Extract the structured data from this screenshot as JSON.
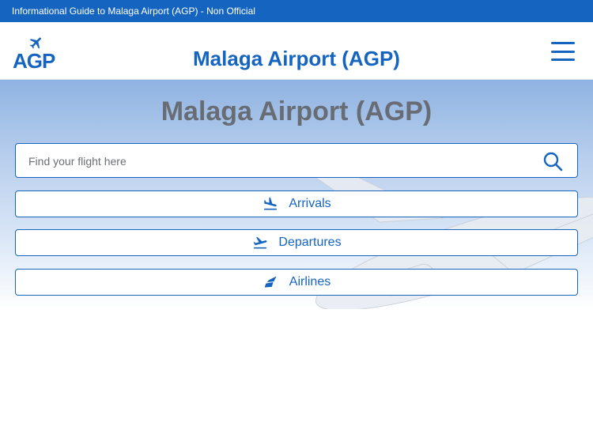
{
  "topbar": {
    "text": "Informational Guide to Malaga Airport (AGP) - Non Official"
  },
  "header": {
    "logo_text": "AGP",
    "title": "Malaga Airport (AGP)"
  },
  "hero": {
    "title": "Malaga Airport (AGP)"
  },
  "search": {
    "placeholder": "Find your flight here"
  },
  "nav": {
    "arrivals": "Arrivals",
    "departures": "Departures",
    "airlines": "Airlines"
  },
  "colors": {
    "brand": "#1565c0",
    "hero_title": "#686d75"
  }
}
